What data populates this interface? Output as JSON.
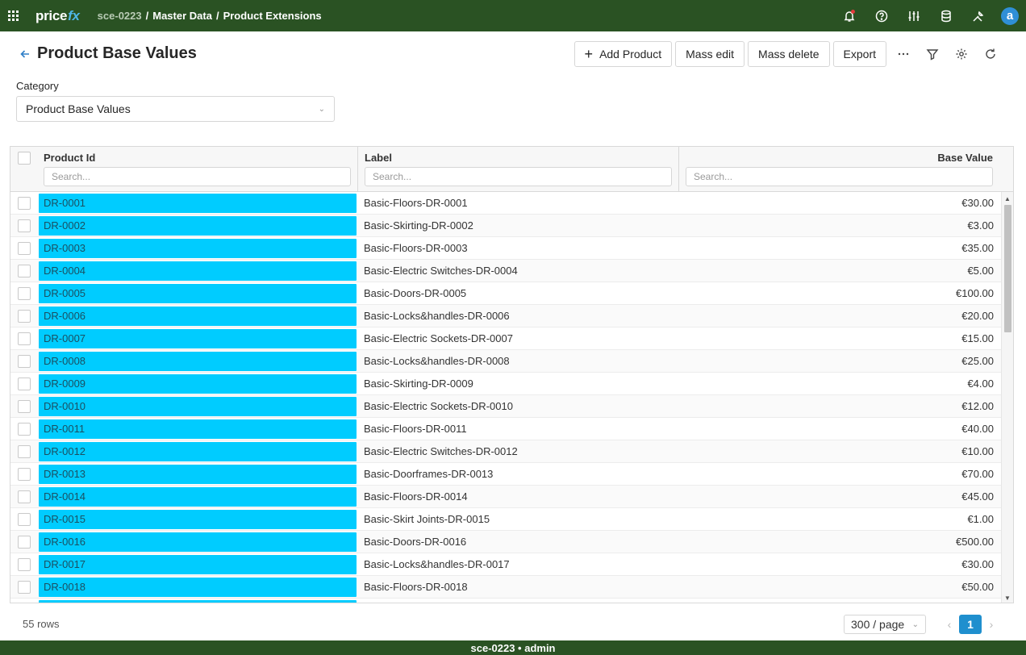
{
  "topbar": {
    "logo_main": "price",
    "logo_accent": "fx",
    "breadcrumb": [
      "sce-0223",
      "/",
      "Master Data",
      "/",
      "Product Extensions"
    ],
    "icons": [
      "bell-icon",
      "help-icon",
      "sliders-icon",
      "database-icon",
      "tools-icon"
    ],
    "avatar_letter": "a"
  },
  "header": {
    "title": "Product Base Values",
    "add_product_label": "Add Product",
    "mass_edit_label": "Mass edit",
    "mass_delete_label": "Mass delete",
    "export_label": "Export",
    "more_label": "···"
  },
  "category": {
    "label": "Category",
    "selected": "Product Base Values"
  },
  "grid": {
    "columns": [
      {
        "title": "Product Id",
        "placeholder": "Search..."
      },
      {
        "title": "Label",
        "placeholder": "Search..."
      },
      {
        "title": "Base Value",
        "placeholder": "Search..."
      }
    ],
    "rows": [
      {
        "id": "DR-0001",
        "label": "Basic-Floors-DR-0001",
        "value": "€30.00"
      },
      {
        "id": "DR-0002",
        "label": "Basic-Skirting-DR-0002",
        "value": "€3.00"
      },
      {
        "id": "DR-0003",
        "label": "Basic-Floors-DR-0003",
        "value": "€35.00"
      },
      {
        "id": "DR-0004",
        "label": "Basic-Electric Switches-DR-0004",
        "value": "€5.00"
      },
      {
        "id": "DR-0005",
        "label": "Basic-Doors-DR-0005",
        "value": "€100.00"
      },
      {
        "id": "DR-0006",
        "label": "Basic-Locks&handles-DR-0006",
        "value": "€20.00"
      },
      {
        "id": "DR-0007",
        "label": "Basic-Electric Sockets-DR-0007",
        "value": "€15.00"
      },
      {
        "id": "DR-0008",
        "label": "Basic-Locks&handles-DR-0008",
        "value": "€25.00"
      },
      {
        "id": "DR-0009",
        "label": "Basic-Skirting-DR-0009",
        "value": "€4.00"
      },
      {
        "id": "DR-0010",
        "label": "Basic-Electric Sockets-DR-0010",
        "value": "€12.00"
      },
      {
        "id": "DR-0011",
        "label": "Basic-Floors-DR-0011",
        "value": "€40.00"
      },
      {
        "id": "DR-0012",
        "label": "Basic-Electric Switches-DR-0012",
        "value": "€10.00"
      },
      {
        "id": "DR-0013",
        "label": "Basic-Doorframes-DR-0013",
        "value": "€70.00"
      },
      {
        "id": "DR-0014",
        "label": "Basic-Floors-DR-0014",
        "value": "€45.00"
      },
      {
        "id": "DR-0015",
        "label": "Basic-Skirt Joints-DR-0015",
        "value": "€1.00"
      },
      {
        "id": "DR-0016",
        "label": "Basic-Doors-DR-0016",
        "value": "€500.00"
      },
      {
        "id": "DR-0017",
        "label": "Basic-Locks&handles-DR-0017",
        "value": "€30.00"
      },
      {
        "id": "DR-0018",
        "label": "Basic-Floors-DR-0018",
        "value": "€50.00"
      },
      {
        "id": "",
        "label": "",
        "value": ""
      }
    ]
  },
  "footer": {
    "rows_count": "55 rows",
    "page_size": "300 / page",
    "current_page": "1"
  },
  "statusbar": {
    "text": "sce-0223 • admin"
  },
  "colors": {
    "topbar_bg": "#2a5223",
    "id_cell_bg": "#00ccff",
    "page_active": "#1f8fce",
    "logo_accent": "#4fb7e8"
  }
}
